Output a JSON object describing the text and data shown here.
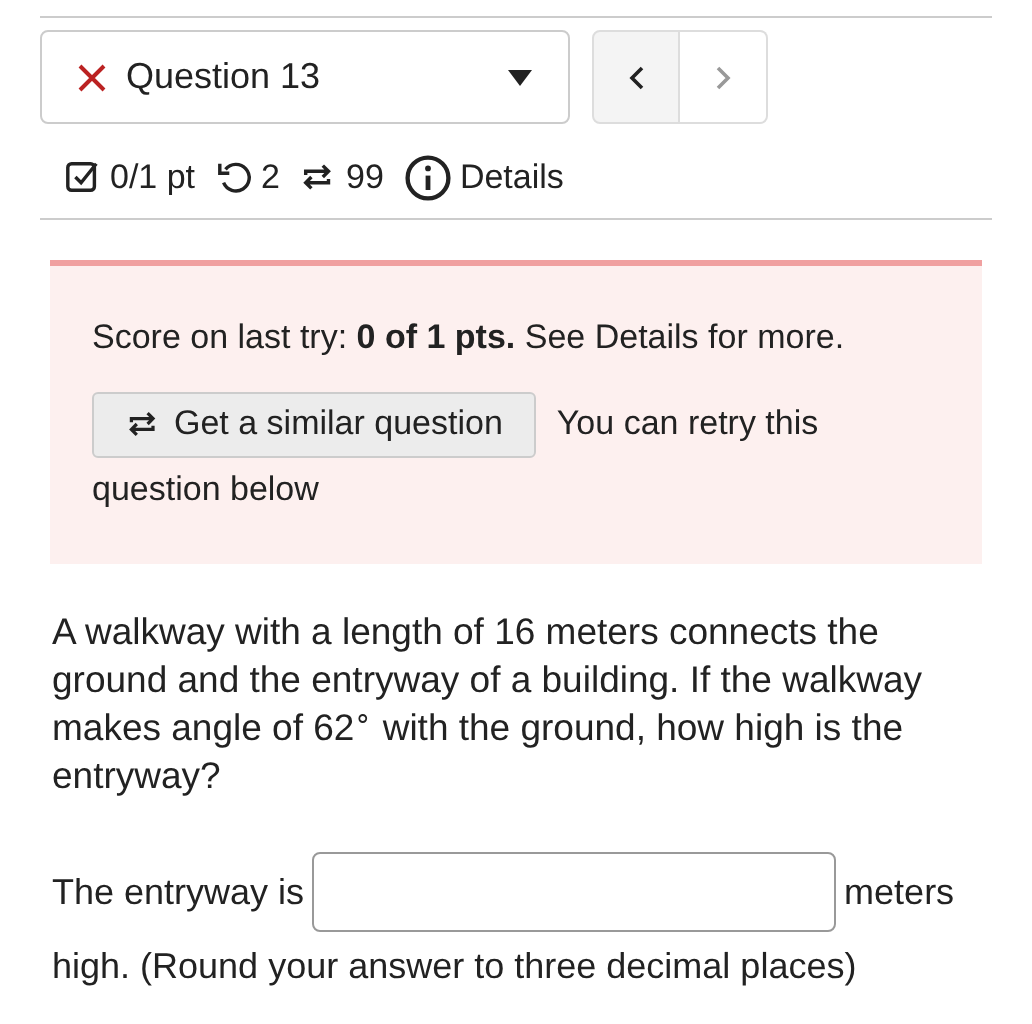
{
  "question_select": {
    "label": "Question 13",
    "correct": false
  },
  "nav_buttons": [
    {
      "kind": "prev",
      "disabled": false
    },
    {
      "kind": "next",
      "disabled": true
    }
  ],
  "stats": [
    {
      "kind": "score",
      "text": "0/1 pt"
    },
    {
      "kind": "retries",
      "text": "2"
    },
    {
      "kind": "versions",
      "text": "99"
    },
    {
      "kind": "details",
      "text": "Details"
    }
  ],
  "alert": {
    "message": "Score on last try: **0 of 1 pts.** See Details for more.",
    "button": "Get a similar question",
    "note_lines": [
      "You can retry this",
      "question below"
    ]
  },
  "question": "A walkway with a length of 16 meters connects the ground and the entryway of a building. If the walkway makes angle of 62$^{∘}$ with the ground, how high is the entryway?",
  "answer": {
    "before": "The entryway is",
    "after_lines": [
      "meters",
      "high. (Round your answer to three decimal places)"
    ]
  }
}
